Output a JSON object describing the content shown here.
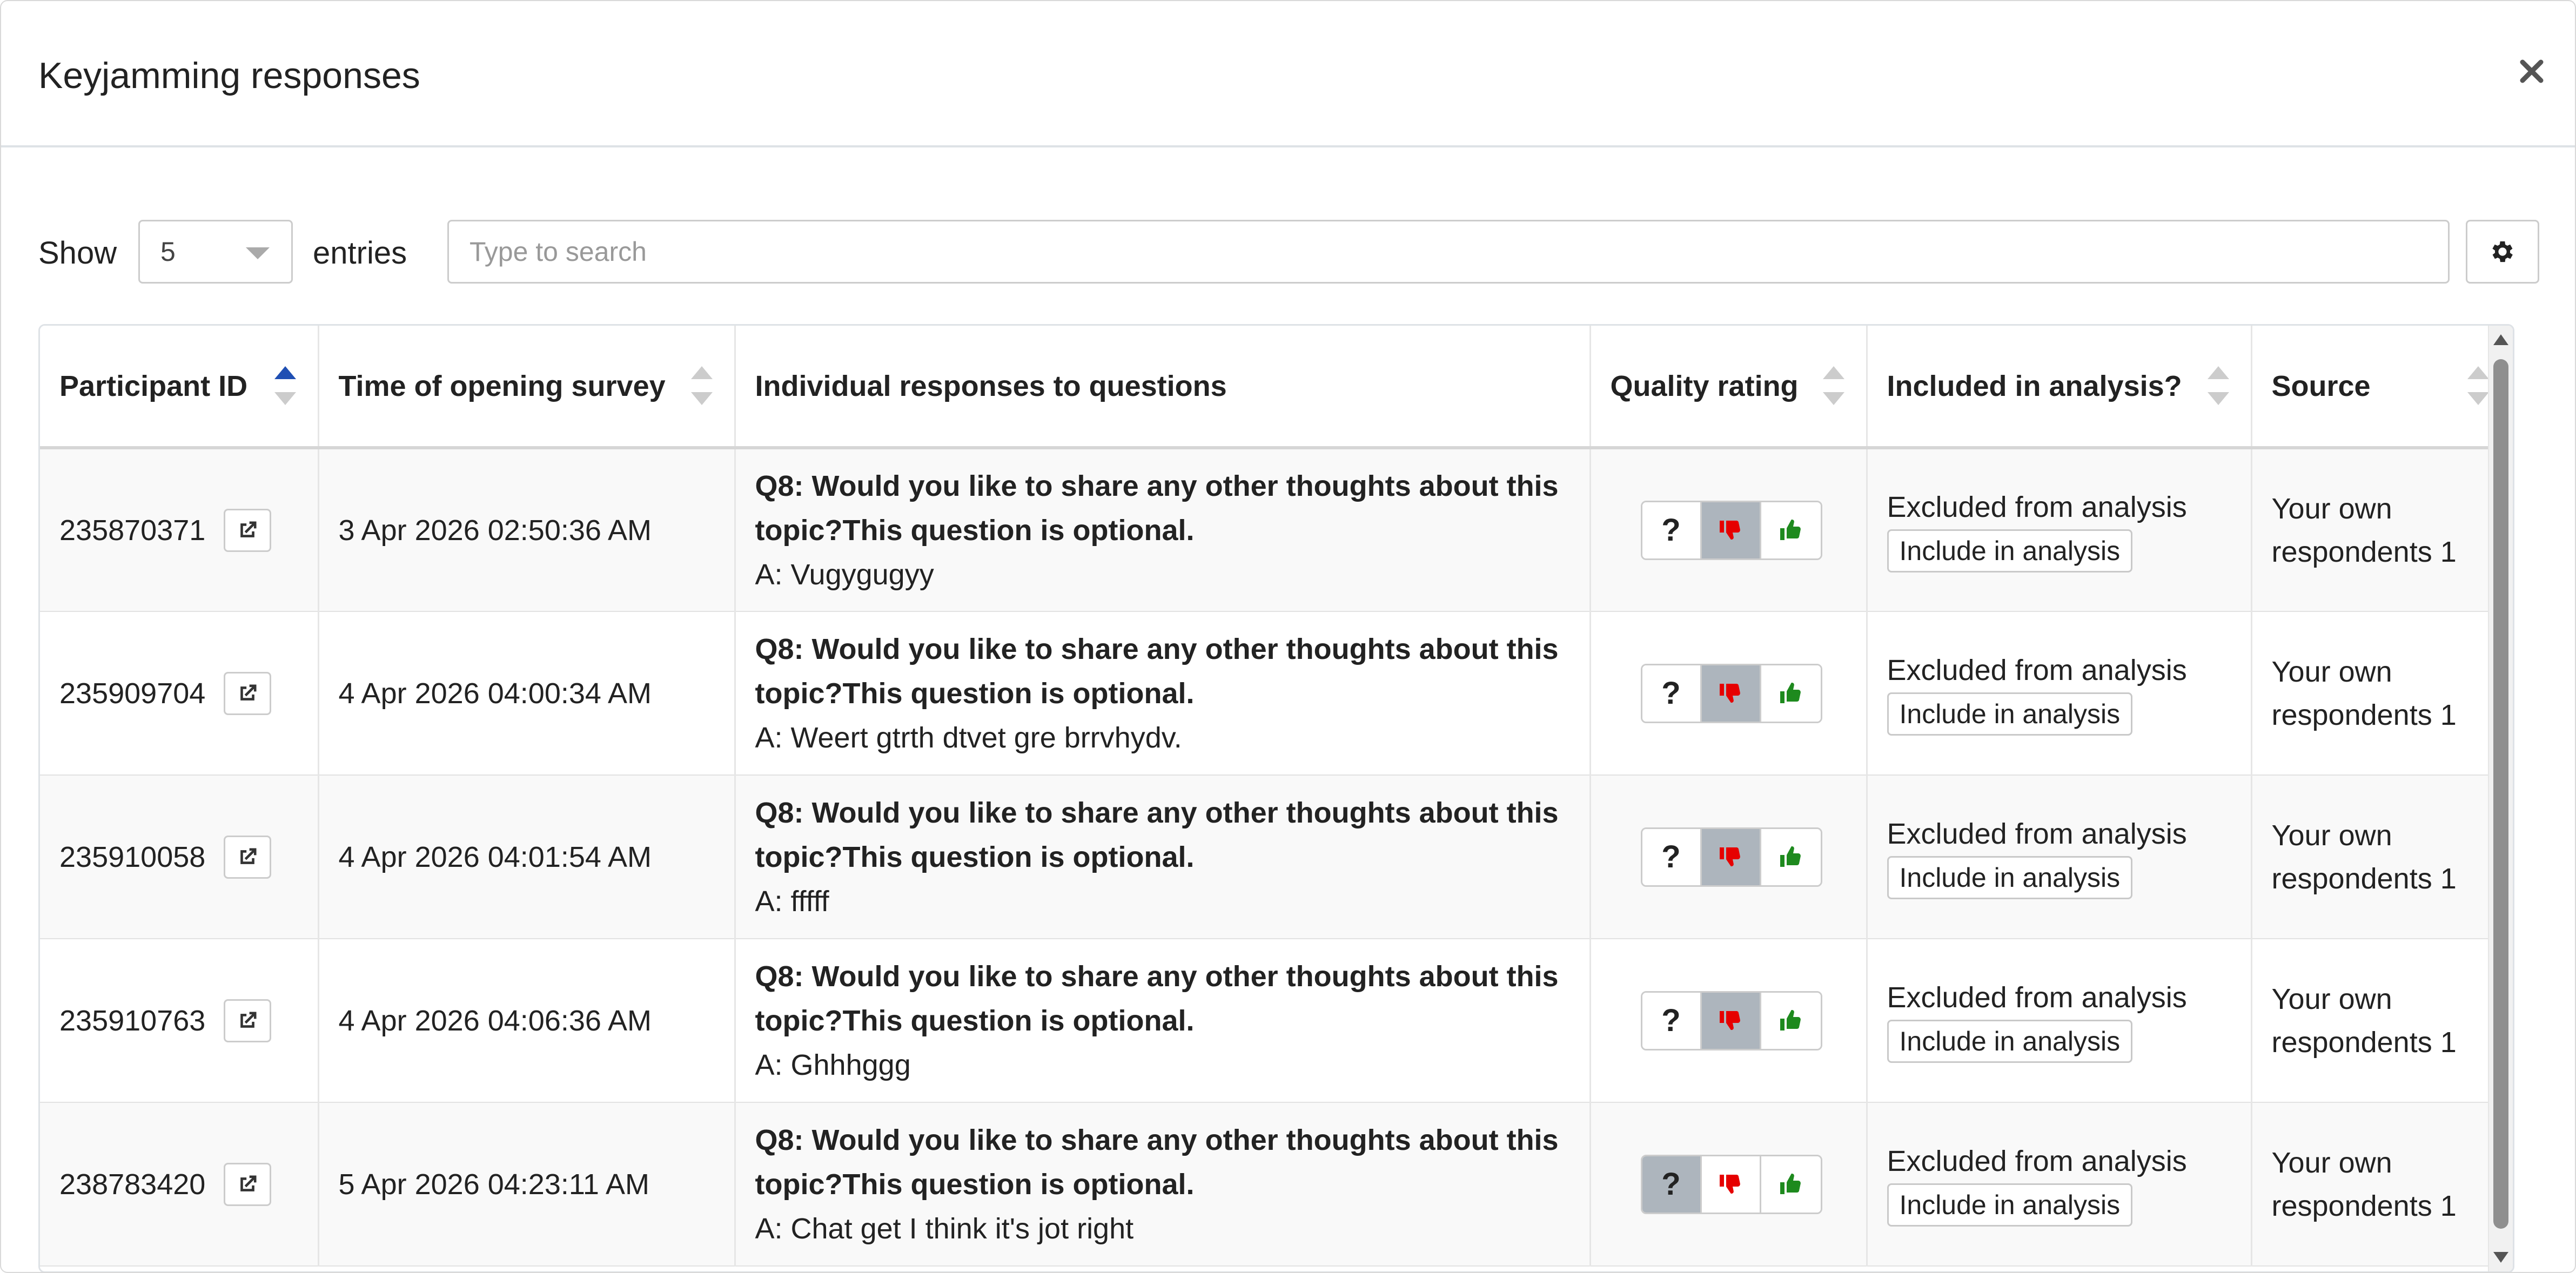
{
  "modal": {
    "title": "Keyjamming responses"
  },
  "controls": {
    "show_label": "Show",
    "page_size": "5",
    "entries_label": "entries",
    "search_placeholder": "Type to search"
  },
  "table": {
    "columns": [
      "Participant ID",
      "Time of opening survey",
      "Individual responses to questions",
      "Quality rating",
      "Included in analysis?",
      "Source"
    ],
    "sorted_column": "Participant ID",
    "sort_direction": "ascending",
    "rows": [
      {
        "participant_id": "235870371",
        "time": "3 Apr 2026 02:50:36 AM",
        "question": "Q8: Would you like to share any other thoughts about this topic?This question is optional.",
        "answer": "A: Vugygugyy",
        "rating": "thumbs-down",
        "status": "Excluded from analysis",
        "action": "Include in analysis",
        "source": "Your own respondents 1"
      },
      {
        "participant_id": "235909704",
        "time": "4 Apr 2026 04:00:34 AM",
        "question": "Q8: Would you like to share any other thoughts about this topic?This question is optional.",
        "answer": "A: Weert gtrth dtvet gre brrvhydv.",
        "rating": "thumbs-down",
        "status": "Excluded from analysis",
        "action": "Include in analysis",
        "source": "Your own respondents 1"
      },
      {
        "participant_id": "235910058",
        "time": "4 Apr 2026 04:01:54 AM",
        "question": "Q8: Would you like to share any other thoughts about this topic?This question is optional.",
        "answer": "A: fffff",
        "rating": "thumbs-down",
        "status": "Excluded from analysis",
        "action": "Include in analysis",
        "source": "Your own respondents 1"
      },
      {
        "participant_id": "235910763",
        "time": "4 Apr 2026 04:06:36 AM",
        "question": "Q8: Would you like to share any other thoughts about this topic?This question is optional.",
        "answer": "A: Ghhhggg",
        "rating": "thumbs-down",
        "status": "Excluded from analysis",
        "action": "Include in analysis",
        "source": "Your own respondents 1"
      },
      {
        "participant_id": "238783420",
        "time": "5 Apr 2026 04:23:11 AM",
        "question": "Q8: Would you like to share any other thoughts about this topic?This question is optional.",
        "answer": "A: Chat get I think it's jot right",
        "rating": "unknown",
        "status": "Excluded from analysis",
        "action": "Include in analysis",
        "source": "Your own respondents 1"
      }
    ]
  },
  "rating_buttons": {
    "unknown_label": "?"
  },
  "icons": {
    "close": "close-icon",
    "settings": "gear-icon",
    "open_participant": "external-link-icon",
    "thumbs_down": "thumbs-down-icon",
    "thumbs_up": "thumbs-up-icon"
  },
  "colors": {
    "sort_active": "#1f4fb3",
    "thumbs_down": "#e60000",
    "thumbs_up": "#1e8a1e",
    "selected_rating": "#adb5bd"
  }
}
